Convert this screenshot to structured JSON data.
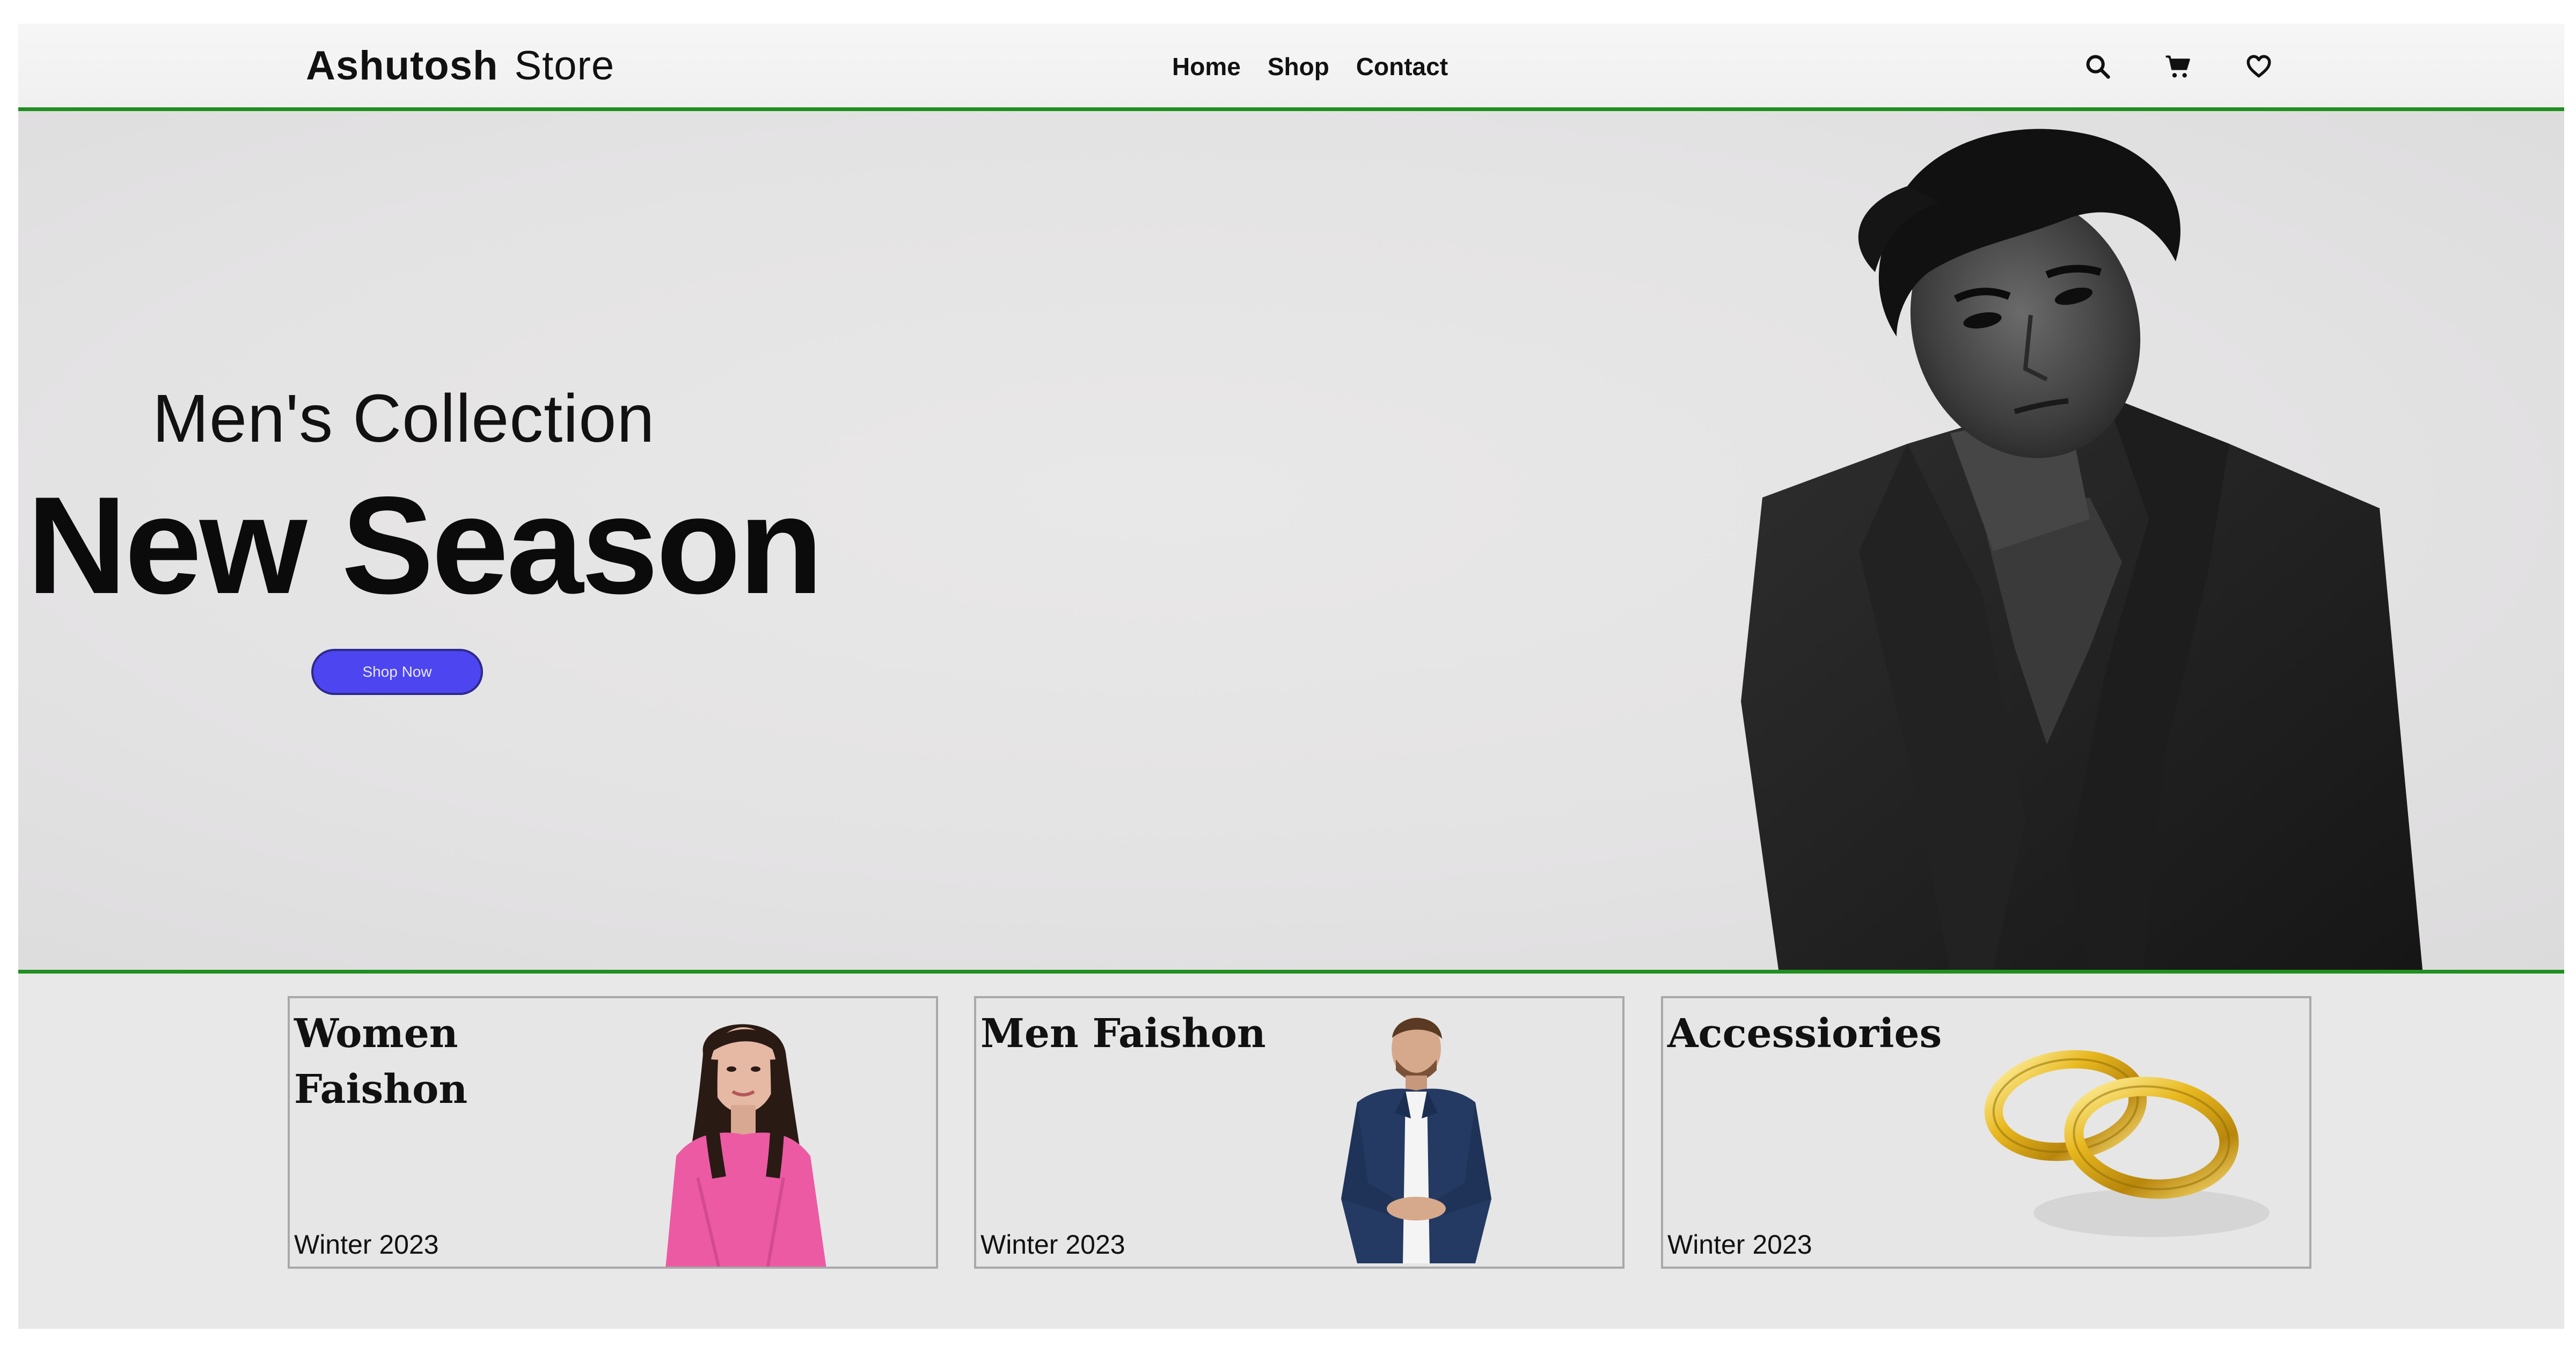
{
  "navbar": {
    "brand_bold": "Ashutosh",
    "brand_light": "Store",
    "links": [
      "Home",
      "Shop",
      "Contact"
    ],
    "icons": [
      "search-icon",
      "cart-icon",
      "heart-icon"
    ]
  },
  "hero": {
    "subtitle": "Men's Collection",
    "title": "New Season",
    "button_label": "Shop Now"
  },
  "categories": [
    {
      "title": "Women Faishon",
      "season": "Winter 2023"
    },
    {
      "title": "Men Faishon",
      "season": "Winter 2023"
    },
    {
      "title": "Accessiories",
      "season": "Winter 2023"
    }
  ],
  "colors": {
    "accent_green": "#1f8f1f",
    "button_blue": "#4d45f0",
    "background": "#e8e8e8"
  }
}
